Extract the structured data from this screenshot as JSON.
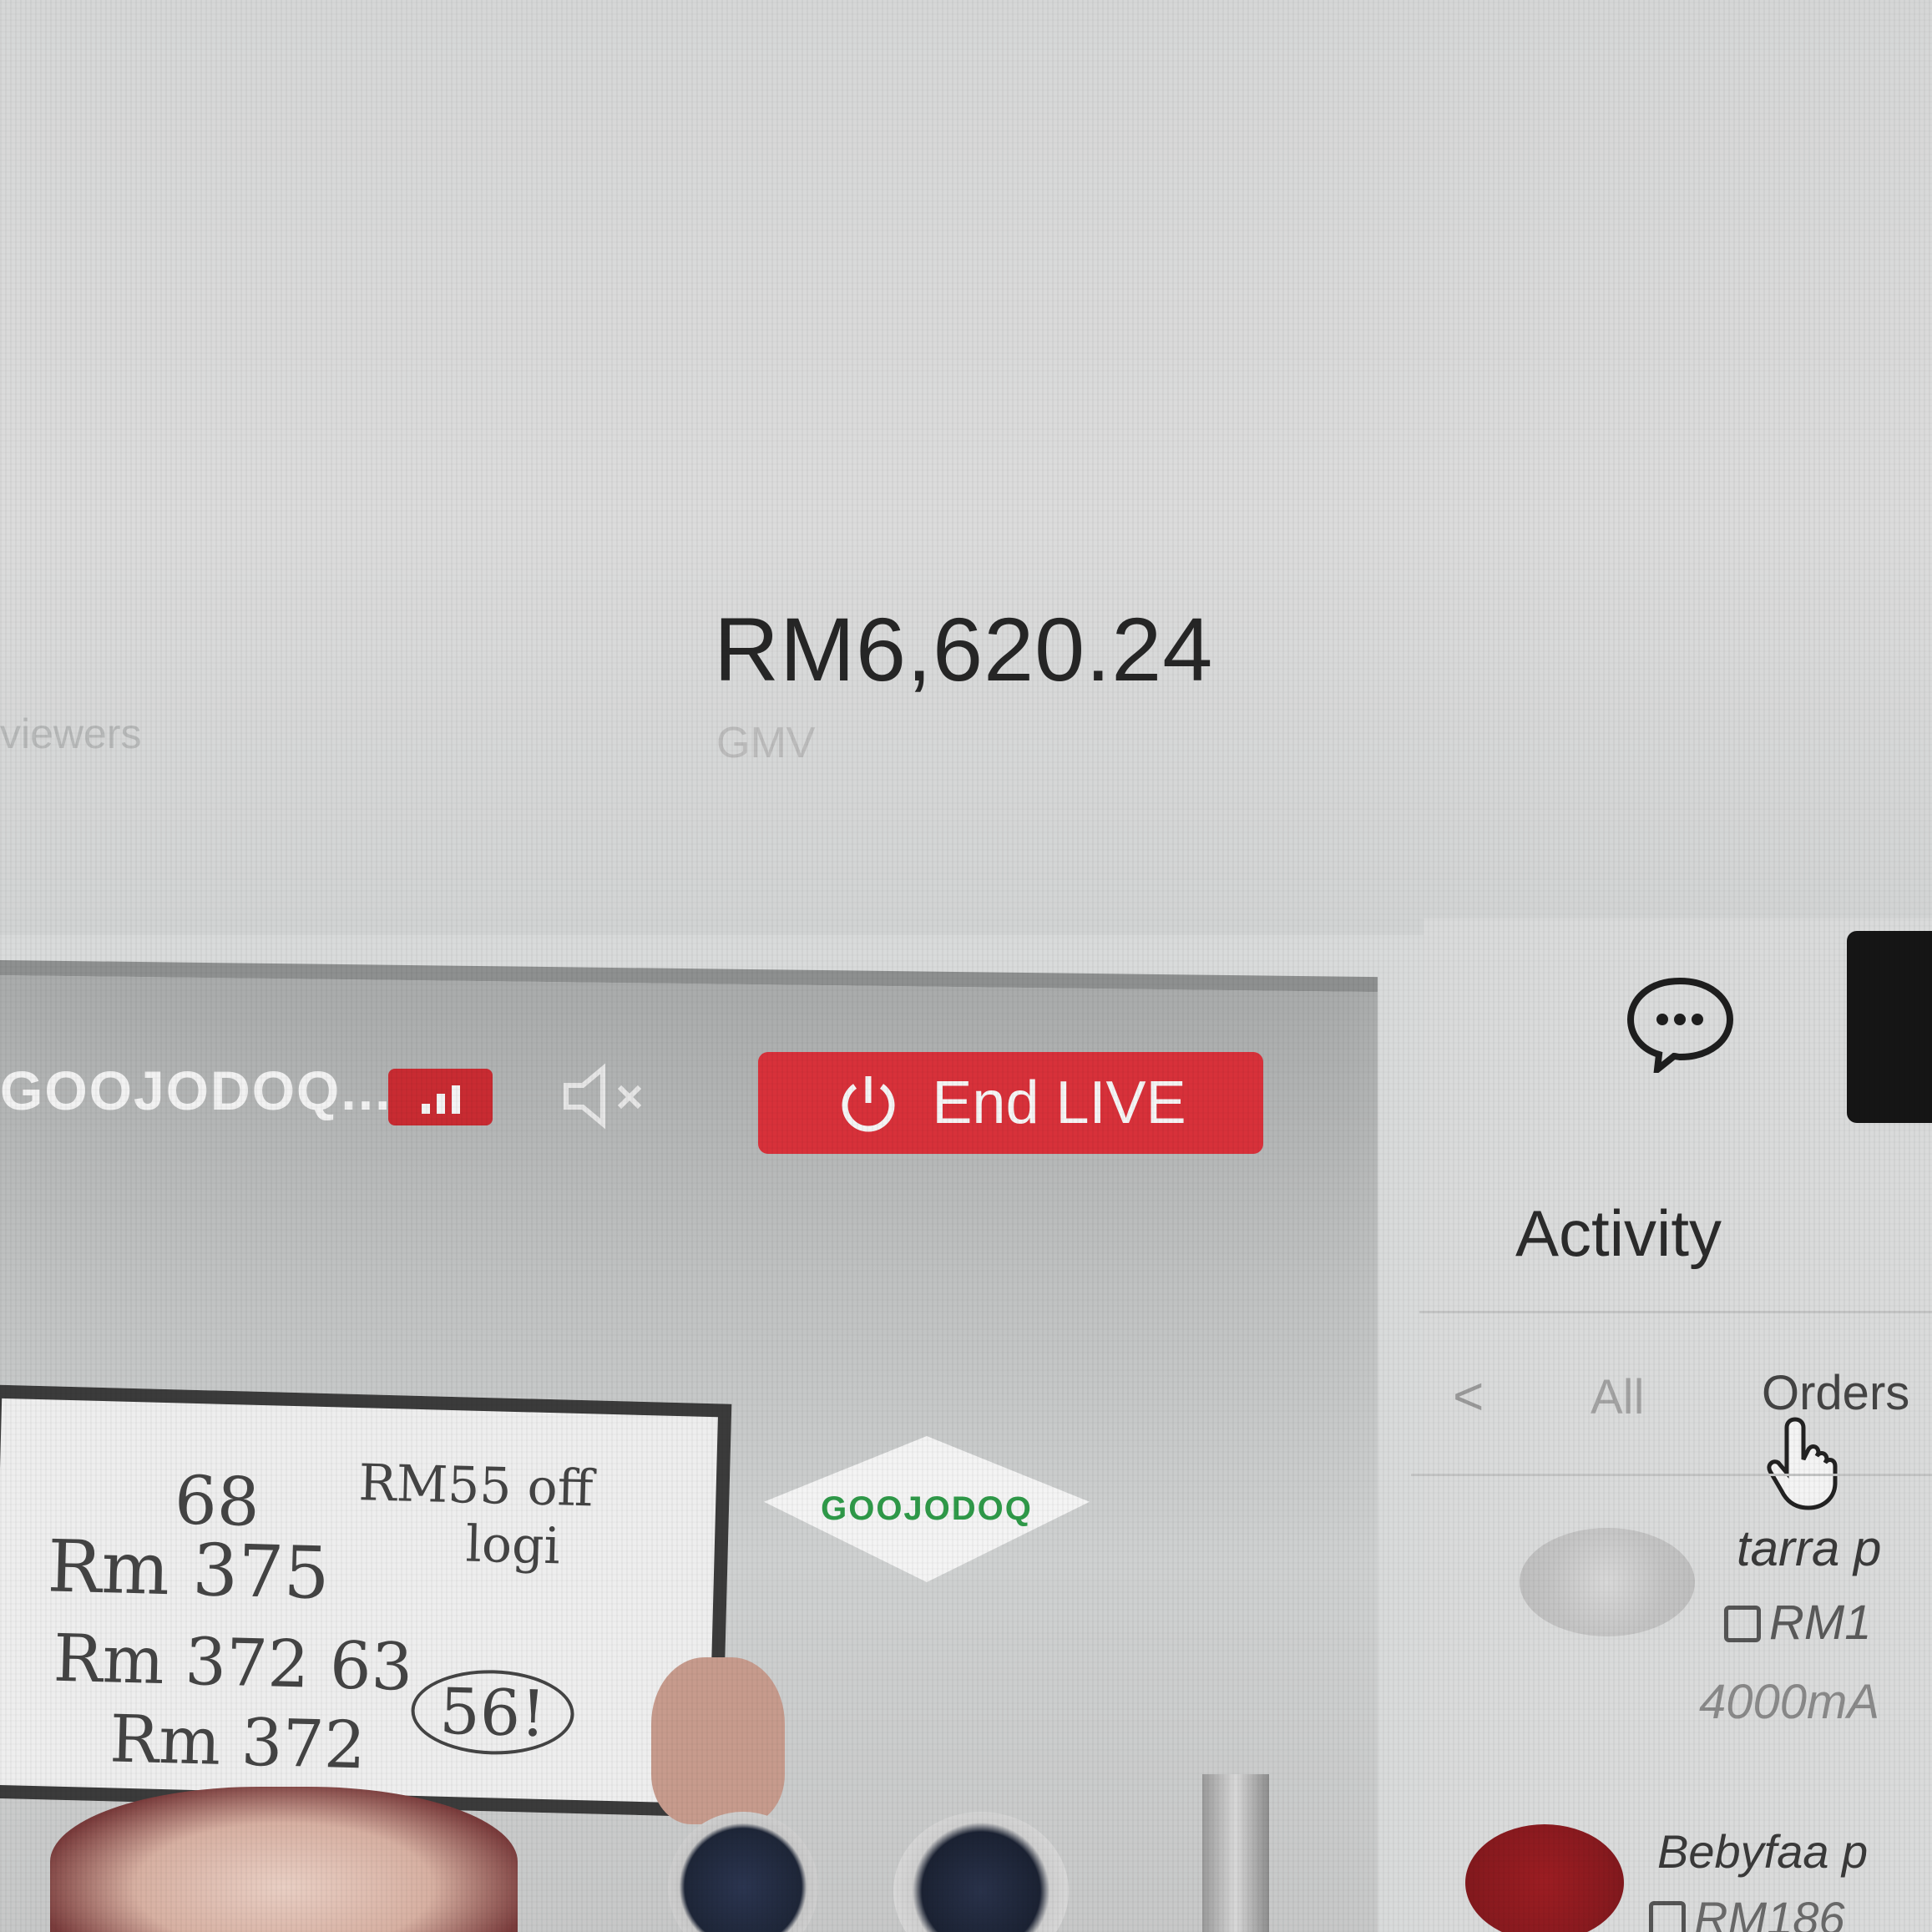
{
  "metrics": {
    "left_label": "viewers",
    "gmv_value": "RM6,620.24",
    "gmv_label": "GMV"
  },
  "live": {
    "shop_name": "GOOJODOQ...",
    "end_live_label": "End LIVE"
  },
  "video": {
    "board_lines": [
      "68",
      "Rm 375",
      "Rm 372 63",
      "Rm 372",
      "56!",
      "RM55 off",
      "logi"
    ],
    "brand_logo_text": "GOOJODOQ"
  },
  "activity": {
    "title": "Activity",
    "tabs": {
      "back": "<",
      "all": "All",
      "orders": "Orders"
    },
    "items": [
      {
        "name": "tarra p",
        "price": "RM1",
        "description": "4000mA"
      },
      {
        "name": "Bebyfaa p",
        "price": "RM186"
      }
    ]
  },
  "colors": {
    "end_live_bg": "#d8313a",
    "signal_badge_bg": "#c92b32",
    "sidebar_dark_tab": "#151515"
  }
}
